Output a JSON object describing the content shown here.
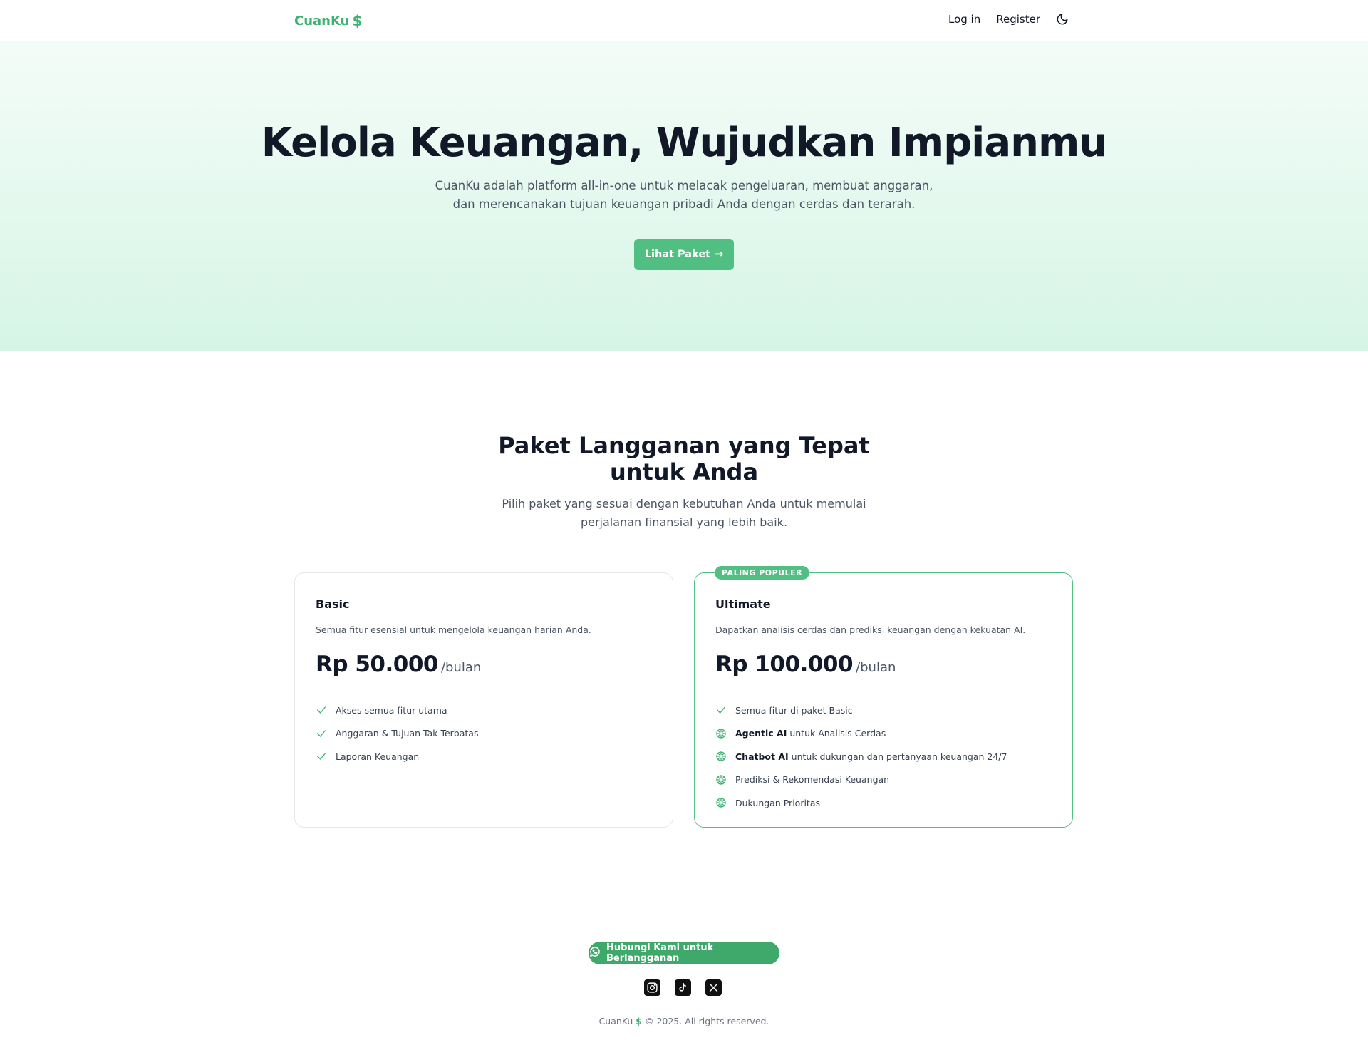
{
  "navbar": {
    "brand": "CuanKu",
    "brand_icon": "dollar-icon",
    "login_label": "Log in",
    "register_label": "Register",
    "theme_icon": "moon-icon"
  },
  "hero": {
    "title": "Kelola Keuangan, Wujudkan Impianmu",
    "subtitle": "CuanKu adalah platform all-in-one untuk melacak pengeluaran, membuat anggaran, dan merencanakan tujuan keuangan pribadi Anda dengan cerdas dan terarah.",
    "cta_label": "Lihat Paket",
    "cta_arrow": "→"
  },
  "pricing": {
    "title": "Paket Langganan yang Tepat untuk Anda",
    "subtitle": "Pilih paket yang sesuai dengan kebutuhan Anda untuk memulai perjalanan finansial yang lebih baik.",
    "plans": [
      {
        "name": "Basic",
        "description": "Semua fitur esensial untuk mengelola keuangan harian Anda.",
        "price": "Rp 50.000",
        "period": "/bulan",
        "features": [
          {
            "icon": "check-icon",
            "bold": "",
            "text": "Akses semua fitur utama"
          },
          {
            "icon": "check-icon",
            "bold": "",
            "text": "Anggaran & Tujuan Tak Terbatas"
          },
          {
            "icon": "check-icon",
            "bold": "",
            "text": "Laporan Keuangan"
          }
        ]
      },
      {
        "badge": "PALING POPULER",
        "name": "Ultimate",
        "description": "Dapatkan analisis cerdas dan prediksi keuangan dengan kekuatan AI.",
        "price": "Rp 100.000",
        "period": "/bulan",
        "features": [
          {
            "icon": "check-icon",
            "bold": "",
            "text": "Semua fitur di paket Basic"
          },
          {
            "icon": "ai-icon",
            "bold": "Agentic AI",
            "text": " untuk Analisis Cerdas"
          },
          {
            "icon": "ai-icon",
            "bold": "Chatbot AI",
            "text": " untuk dukungan dan pertanyaan keuangan 24/7"
          },
          {
            "icon": "ai-icon",
            "bold": "",
            "text": "Prediksi & Rekomendasi Keuangan"
          },
          {
            "icon": "ai-icon",
            "bold": "",
            "text": "Dukungan Prioritas"
          }
        ]
      }
    ]
  },
  "footer": {
    "contact_label": "Hubungi Kami untuk Berlangganan",
    "contact_icon": "whatsapp-icon",
    "socials": [
      "instagram-icon",
      "tiktok-icon",
      "x-icon"
    ],
    "copyright_brand": "CuanKu",
    "copyright_text": "© 2025. All rights reserved."
  },
  "colors": {
    "accent": "#52bf82",
    "brand": "#3fb173",
    "text": "#111827",
    "muted": "#4b5563"
  }
}
